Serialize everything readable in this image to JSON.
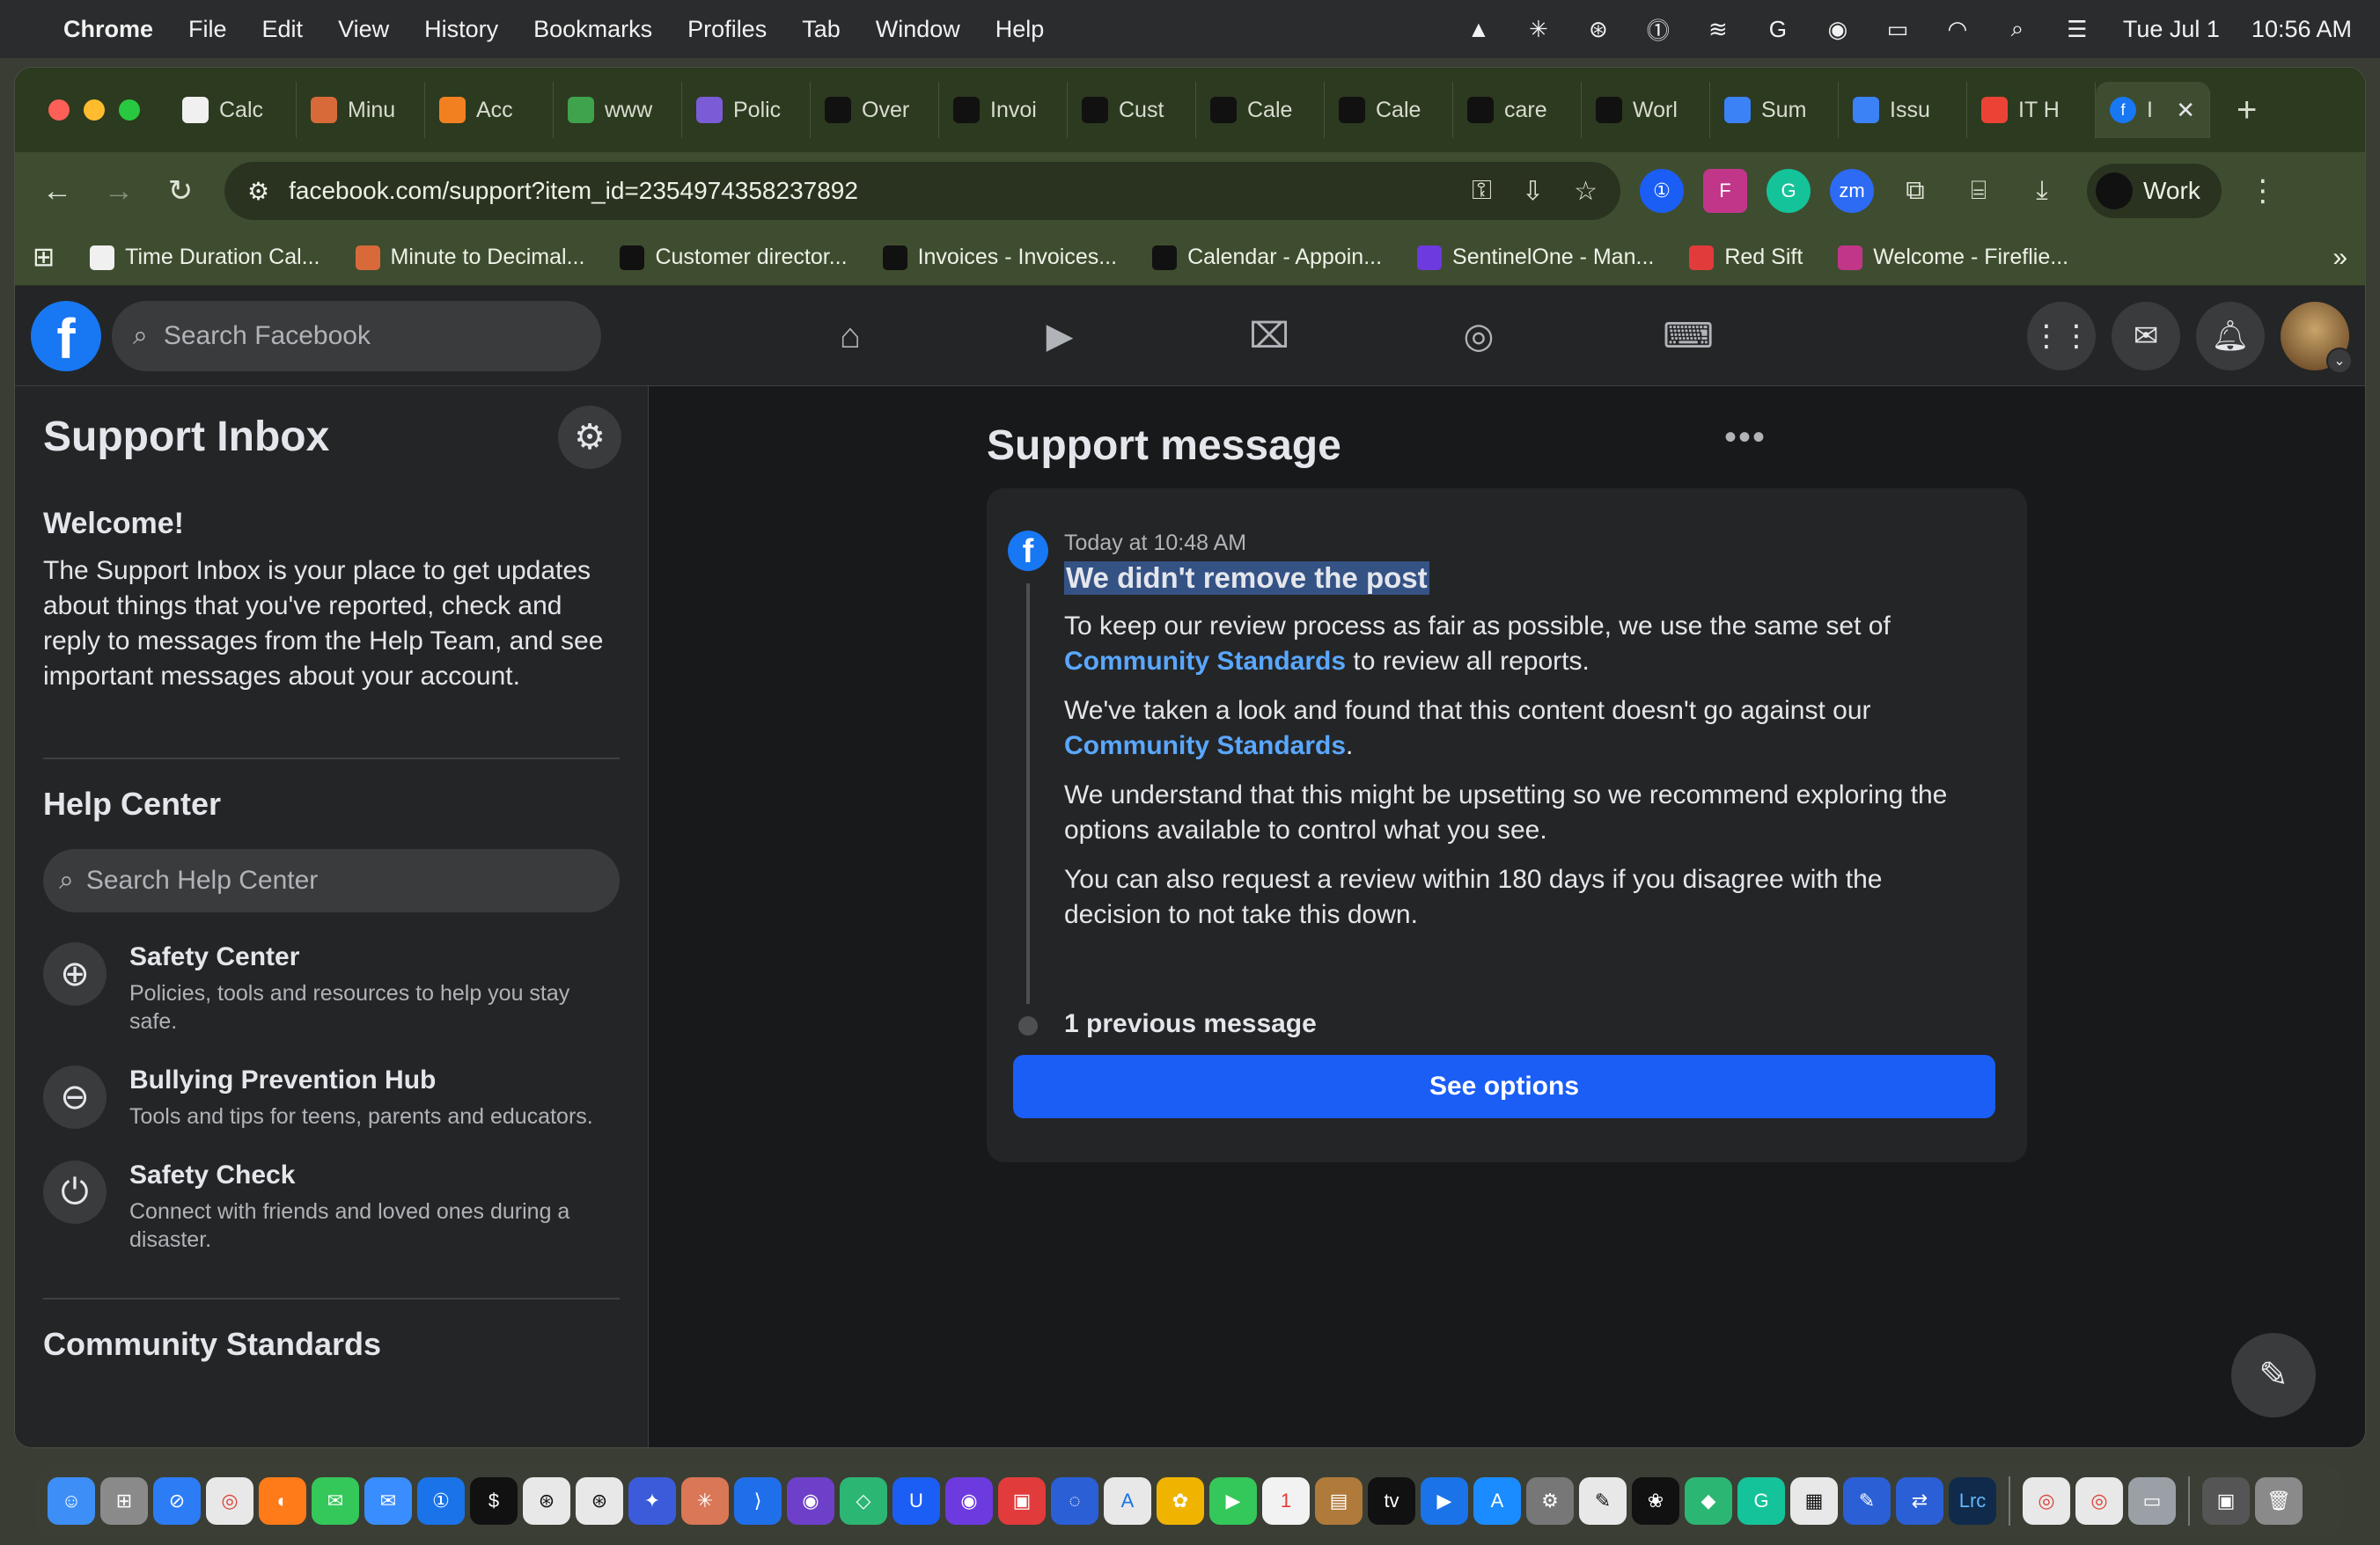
{
  "menubar": {
    "app": "Chrome",
    "items": [
      "File",
      "Edit",
      "View",
      "History",
      "Bookmarks",
      "Profiles",
      "Tab",
      "Window",
      "Help"
    ],
    "date": "Tue Jul 1",
    "time": "10:56 AM"
  },
  "tabs": [
    {
      "label": "Calc",
      "color": "#f0f0f0"
    },
    {
      "label": "Minu",
      "color": "#d86a3a"
    },
    {
      "label": "Acc",
      "color": "#f38020"
    },
    {
      "label": "www",
      "color": "#3fa34d"
    },
    {
      "label": "Polic",
      "color": "#7b5cd6"
    },
    {
      "label": "Over",
      "color": "#111111"
    },
    {
      "label": "Invoi",
      "color": "#111111"
    },
    {
      "label": "Cust",
      "color": "#111111"
    },
    {
      "label": "Cale",
      "color": "#111111"
    },
    {
      "label": "Cale",
      "color": "#111111"
    },
    {
      "label": "care",
      "color": "#111111"
    },
    {
      "label": "Worl",
      "color": "#111111"
    },
    {
      "label": "Sum",
      "color": "#3b82f6"
    },
    {
      "label": "Issu",
      "color": "#3b82f6"
    },
    {
      "label": "IT H",
      "color": "#ea4335"
    }
  ],
  "active_tab": {
    "label": "I"
  },
  "omnibox": {
    "url": "facebook.com/support?item_id=2354974358237892"
  },
  "profile": {
    "label": "Work"
  },
  "bookmarks": [
    {
      "label": "Time Duration Cal...",
      "color": "#f0f0f0"
    },
    {
      "label": "Minute to Decimal...",
      "color": "#d86a3a"
    },
    {
      "label": "Customer director...",
      "color": "#111111"
    },
    {
      "label": "Invoices - Invoices...",
      "color": "#111111"
    },
    {
      "label": "Calendar - Appoin...",
      "color": "#111111"
    },
    {
      "label": "SentinelOne - Man...",
      "color": "#6d3ae0"
    },
    {
      "label": "Red Sift",
      "color": "#e23b3b"
    },
    {
      "label": "Welcome - Fireflie...",
      "color": "#c2368a"
    }
  ],
  "facebook": {
    "search_placeholder": "Search Facebook"
  },
  "sidebar": {
    "title": "Support Inbox",
    "welcome_heading": "Welcome!",
    "welcome_text": "The Support Inbox is your place to get updates about things that you've reported, check and reply to messages from the Help Team, and see important messages about your account.",
    "help_center_title": "Help Center",
    "help_search_placeholder": "Search Help Center",
    "help_items": [
      {
        "title": "Safety Center",
        "desc": "Policies, tools and resources to help you stay safe.",
        "icon": "lifebuoy-icon"
      },
      {
        "title": "Bullying Prevention Hub",
        "desc": "Tools and tips for teens, parents and educators.",
        "icon": "no-entry-icon"
      },
      {
        "title": "Safety Check",
        "desc": "Connect with friends and loved ones during a disaster.",
        "icon": "power-icon"
      }
    ],
    "community_title": "Community Standards"
  },
  "support_message": {
    "title": "Support message",
    "timestamp": "Today at 10:48 AM",
    "heading": "We didn't remove the post",
    "p1_before": "To keep our review process as fair as possible, we use the same set of",
    "p1_link": "Community Standards",
    "p1_after": " to review all reports.",
    "p2_before": "We've taken a look and found that this content doesn't go against our",
    "p2_link": "Community Standards",
    "p2_after": ".",
    "p3": "We understand that this might be upsetting so we recommend exploring the options available to control what you see.",
    "p4": "You can also request a review within 180 days if you disagree with the decision to not take this down.",
    "previous": "1 previous message",
    "button": "See options"
  },
  "colors": {
    "facebook_blue": "#1877f2",
    "button_blue": "#1b5ef5",
    "link_blue": "#5aa7ff",
    "chrome_tabstrip": "#2c3a1f"
  }
}
